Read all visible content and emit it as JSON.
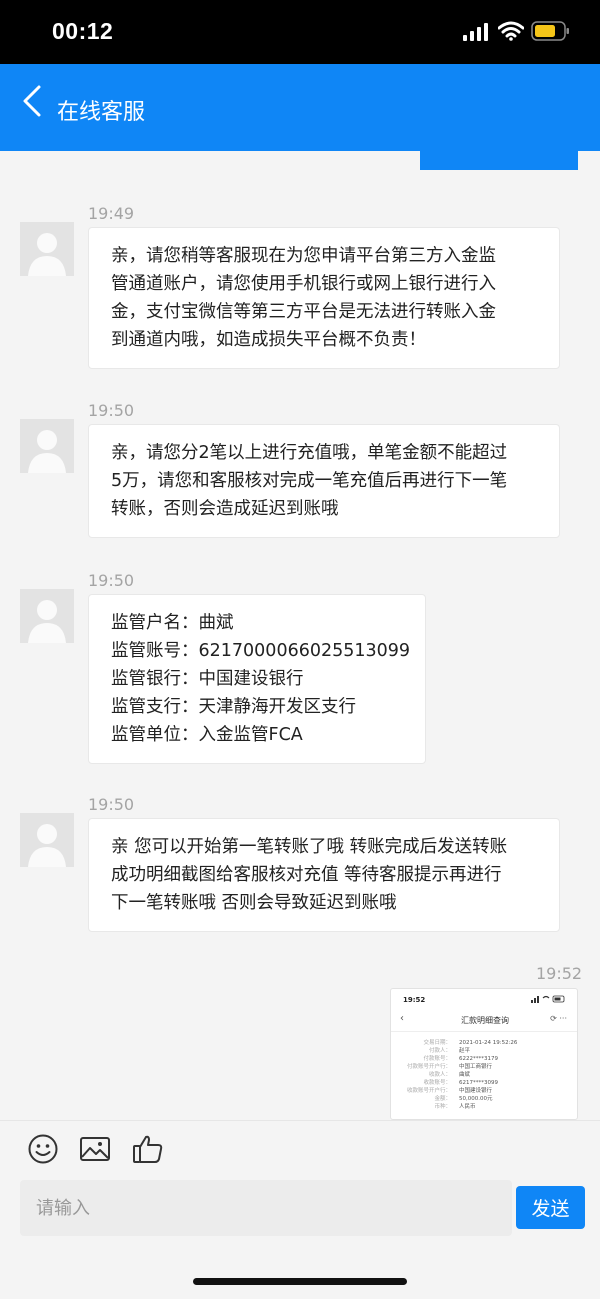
{
  "status_bar": {
    "time": "00:12"
  },
  "nav": {
    "title": "在线客服"
  },
  "messages": [
    {
      "time": "19:49",
      "lines": [
        "亲，请您稍等客服现在为您申请平台第三方入金监",
        "管通道账户，请您使用手机银行或网上银行进行入",
        "金，支付宝微信等第三方平台是无法进行转账入金",
        "到通道内哦，如造成损失平台概不负责！"
      ]
    },
    {
      "time": "19:50",
      "lines": [
        "亲，请您分2笔以上进行充值哦，单笔金额不能超过",
        "5万，请您和客服核对完成一笔充值后再进行下一笔",
        "转账，否则会造成延迟到账哦"
      ]
    },
    {
      "time": "19:50",
      "lines": [
        "监管户名：曲斌",
        "监管账号：6217000066025513099",
        "监管银行：中国建设银行",
        "监管支行：天津静海开发区支行",
        "监管单位：入金监管FCA"
      ]
    },
    {
      "time": "19:50",
      "lines": [
        "亲 您可以开始第一笔转账了哦 转账完成后发送转账",
        "成功明细截图给客服核对充值 等待客服提示再进行",
        "下一笔转账哦 否则会导致延迟到账哦"
      ]
    }
  ],
  "sent_image": {
    "time": "19:52",
    "status_time": "19:52",
    "title": "汇款明细查询",
    "rows": [
      {
        "k": "交易日期：",
        "v": "2021-01-24 19:52:26"
      },
      {
        "k": "付款人：",
        "v": "赵平"
      },
      {
        "k": "付款账号：",
        "v": "6222****3179"
      },
      {
        "k": "付款账号开户行：",
        "v": "中国工商银行"
      },
      {
        "k": "收款人：",
        "v": "曲斌"
      },
      {
        "k": "收款账号：",
        "v": "6217****3099"
      },
      {
        "k": "收款账号开户行：",
        "v": "中国建设银行"
      },
      {
        "k": "金额：",
        "v": "50,000.00元"
      },
      {
        "k": "币种：",
        "v": "人民币"
      }
    ]
  },
  "input": {
    "placeholder": "请输入",
    "value": ""
  },
  "send_label": "发送",
  "colors": {
    "accent": "#0f86f6",
    "background": "#f4f4f4",
    "bubble": "#ffffff"
  },
  "icons": [
    "back-icon",
    "emoji-icon",
    "image-icon",
    "thumbs-up-icon"
  ]
}
